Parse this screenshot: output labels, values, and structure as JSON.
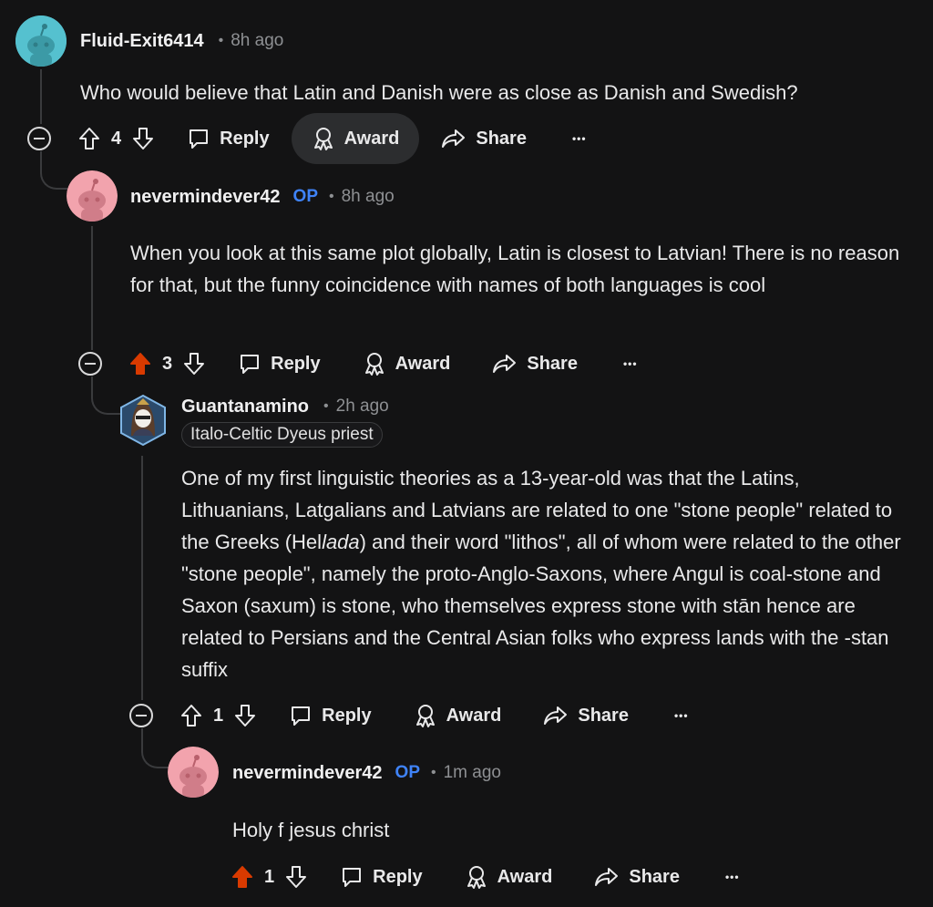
{
  "comments": [
    {
      "username": "Fluid-Exit6414",
      "op": "",
      "time": "8h ago",
      "body": "Who would believe that Latin and Danish were as close as Danish and Swedish?",
      "votes": "4",
      "avatar_color": "#55c1cf"
    },
    {
      "username": "nevermindever42",
      "op": "OP",
      "time": "8h ago",
      "body": "When you look at this same plot globally, Latin is closest to Latvian! There is no reason for that, but the funny coincidence with names of both languages is cool",
      "votes": "3",
      "avatar_color": "#f2a3ad"
    },
    {
      "username": "Guantanamino",
      "op": "",
      "time": "2h ago",
      "flair": "Italo-Celtic Dyeus priest",
      "body_part1": "One of my first linguistic theories as a 13-year-old was that the Latins, Lithuanians, Latgalians and Latvians are related to one \"stone people\" related to the Greeks (Hel",
      "body_italic": "lada",
      "body_part2": ") and their word \"lithos\", all of whom were related to the other \"stone people\", namely the proto-Anglo-Saxons, where Angul is coal-stone and Saxon (saxum) is stone, who themselves express stone with stān hence are related to Persians and the Central Asian folks who express lands with the -stan suffix",
      "votes": "1"
    },
    {
      "username": "nevermindever42",
      "op": "OP",
      "time": "1m ago",
      "body": "Holy f jesus christ",
      "votes": "1",
      "avatar_color": "#f2a3ad"
    }
  ],
  "actions": {
    "reply": "Reply",
    "award": "Award",
    "share": "Share",
    "more": "•••"
  },
  "colors": {
    "upvote_active": "#d93a00",
    "op_badge": "#3f83f8",
    "background": "#131314"
  }
}
